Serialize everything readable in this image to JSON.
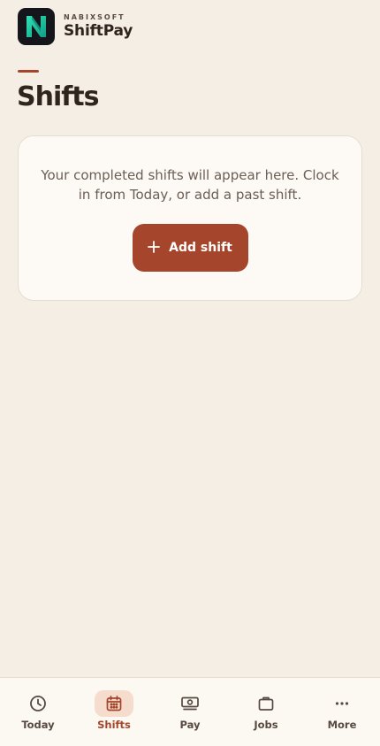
{
  "brand": {
    "company": "NABIXSOFT",
    "product": "ShiftPay",
    "logo_icon": "letter-n-logo-icon"
  },
  "page": {
    "title": "Shifts"
  },
  "empty_state": {
    "message": "Your completed shifts will appear here. Clock in from Today, or add a past shift.",
    "add_button_label": "Add shift",
    "add_button_icon": "plus-icon"
  },
  "nav": {
    "active": "Shifts",
    "items": [
      {
        "label": "Today",
        "icon": "clock-icon"
      },
      {
        "label": "Shifts",
        "icon": "calendar-icon"
      },
      {
        "label": "Pay",
        "icon": "banknote-icon"
      },
      {
        "label": "Jobs",
        "icon": "briefcase-icon"
      },
      {
        "label": "More",
        "icon": "more-dots-icon"
      }
    ]
  },
  "colors": {
    "background": "#f5eee5",
    "accent": "#a5452b",
    "active_nav_bg": "#f6dccd",
    "logo_bg": "#15161b",
    "logo_teal": "#1fd0a6"
  }
}
